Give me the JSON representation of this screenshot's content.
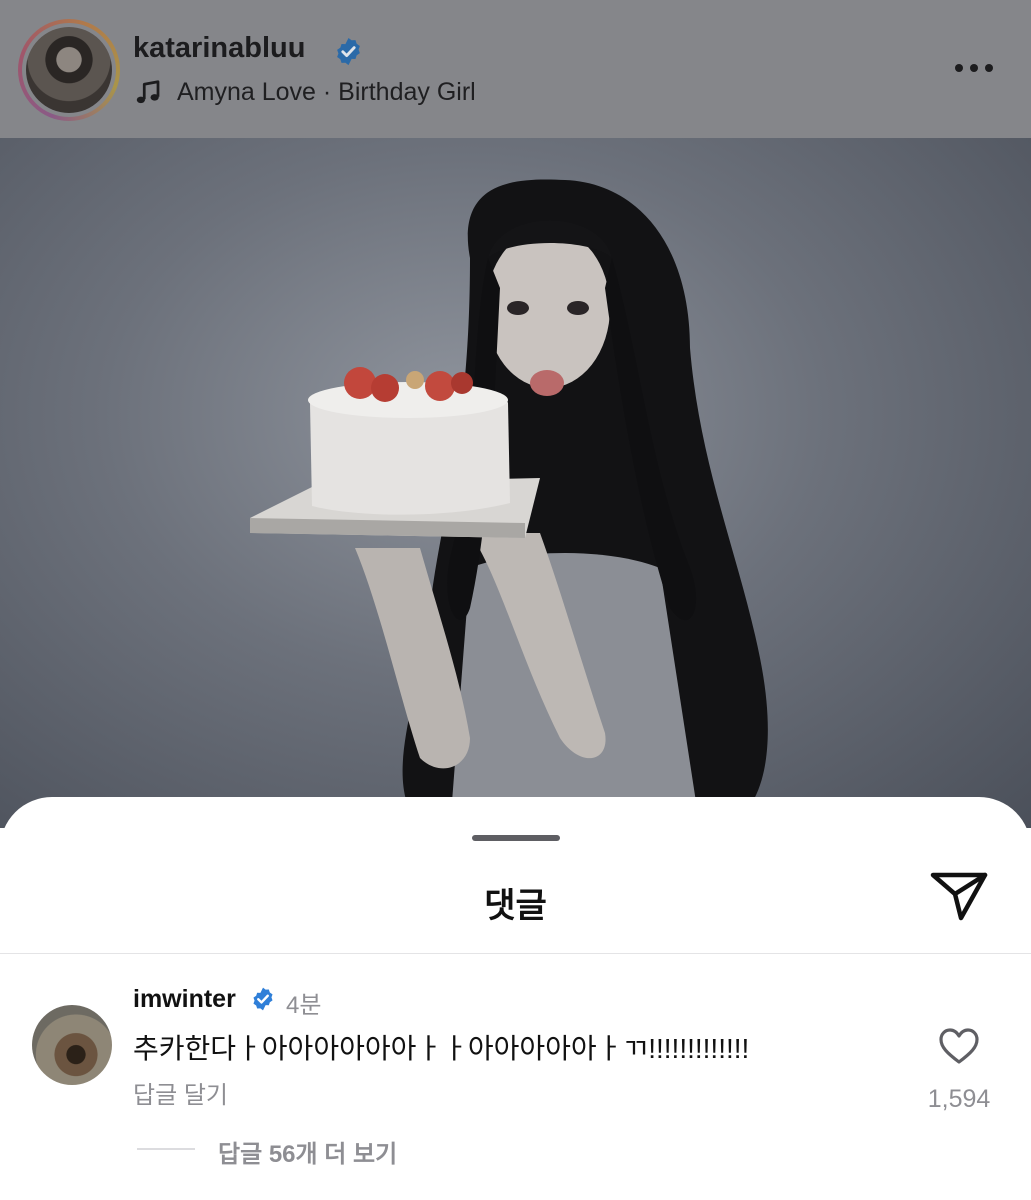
{
  "post": {
    "username": "katarinabluu",
    "audio": "Amyna Love · Birthday Girl"
  },
  "comments_sheet": {
    "title": "댓글"
  },
  "comment": {
    "username": "imwinter",
    "time": "4분",
    "text": "추카한다ㅏ아아아아아아ㅏㅏ아아아아아ㅏㄲ!!!!!!!!!!!!!",
    "reply_label": "답글 달기",
    "like_count": "1,594",
    "view_replies_label": "답글 56개 더 보기"
  },
  "icons": {
    "verified": "verified-badge-icon",
    "music": "music-note-icon",
    "more": "more-options-icon",
    "share": "send-share-icon",
    "like": "heart-icon"
  },
  "colors": {
    "verified_blue": "#2f7fd8",
    "muted_text": "#8e8e93",
    "dim_overlay": "#85868a"
  }
}
